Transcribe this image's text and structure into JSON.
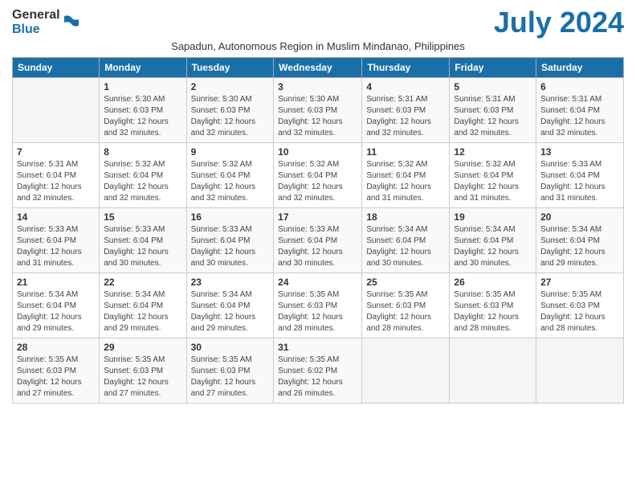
{
  "logo": {
    "general": "General",
    "blue": "Blue"
  },
  "month_title": "July 2024",
  "subtitle": "Sapadun, Autonomous Region in Muslim Mindanao, Philippines",
  "weekdays": [
    "Sunday",
    "Monday",
    "Tuesday",
    "Wednesday",
    "Thursday",
    "Friday",
    "Saturday"
  ],
  "weeks": [
    [
      {
        "day": "",
        "sunrise": "",
        "sunset": "",
        "daylight": ""
      },
      {
        "day": "1",
        "sunrise": "Sunrise: 5:30 AM",
        "sunset": "Sunset: 6:03 PM",
        "daylight": "Daylight: 12 hours and 32 minutes."
      },
      {
        "day": "2",
        "sunrise": "Sunrise: 5:30 AM",
        "sunset": "Sunset: 6:03 PM",
        "daylight": "Daylight: 12 hours and 32 minutes."
      },
      {
        "day": "3",
        "sunrise": "Sunrise: 5:30 AM",
        "sunset": "Sunset: 6:03 PM",
        "daylight": "Daylight: 12 hours and 32 minutes."
      },
      {
        "day": "4",
        "sunrise": "Sunrise: 5:31 AM",
        "sunset": "Sunset: 6:03 PM",
        "daylight": "Daylight: 12 hours and 32 minutes."
      },
      {
        "day": "5",
        "sunrise": "Sunrise: 5:31 AM",
        "sunset": "Sunset: 6:03 PM",
        "daylight": "Daylight: 12 hours and 32 minutes."
      },
      {
        "day": "6",
        "sunrise": "Sunrise: 5:31 AM",
        "sunset": "Sunset: 6:04 PM",
        "daylight": "Daylight: 12 hours and 32 minutes."
      }
    ],
    [
      {
        "day": "7",
        "sunrise": "Sunrise: 5:31 AM",
        "sunset": "Sunset: 6:04 PM",
        "daylight": "Daylight: 12 hours and 32 minutes."
      },
      {
        "day": "8",
        "sunrise": "Sunrise: 5:32 AM",
        "sunset": "Sunset: 6:04 PM",
        "daylight": "Daylight: 12 hours and 32 minutes."
      },
      {
        "day": "9",
        "sunrise": "Sunrise: 5:32 AM",
        "sunset": "Sunset: 6:04 PM",
        "daylight": "Daylight: 12 hours and 32 minutes."
      },
      {
        "day": "10",
        "sunrise": "Sunrise: 5:32 AM",
        "sunset": "Sunset: 6:04 PM",
        "daylight": "Daylight: 12 hours and 32 minutes."
      },
      {
        "day": "11",
        "sunrise": "Sunrise: 5:32 AM",
        "sunset": "Sunset: 6:04 PM",
        "daylight": "Daylight: 12 hours and 31 minutes."
      },
      {
        "day": "12",
        "sunrise": "Sunrise: 5:32 AM",
        "sunset": "Sunset: 6:04 PM",
        "daylight": "Daylight: 12 hours and 31 minutes."
      },
      {
        "day": "13",
        "sunrise": "Sunrise: 5:33 AM",
        "sunset": "Sunset: 6:04 PM",
        "daylight": "Daylight: 12 hours and 31 minutes."
      }
    ],
    [
      {
        "day": "14",
        "sunrise": "Sunrise: 5:33 AM",
        "sunset": "Sunset: 6:04 PM",
        "daylight": "Daylight: 12 hours and 31 minutes."
      },
      {
        "day": "15",
        "sunrise": "Sunrise: 5:33 AM",
        "sunset": "Sunset: 6:04 PM",
        "daylight": "Daylight: 12 hours and 30 minutes."
      },
      {
        "day": "16",
        "sunrise": "Sunrise: 5:33 AM",
        "sunset": "Sunset: 6:04 PM",
        "daylight": "Daylight: 12 hours and 30 minutes."
      },
      {
        "day": "17",
        "sunrise": "Sunrise: 5:33 AM",
        "sunset": "Sunset: 6:04 PM",
        "daylight": "Daylight: 12 hours and 30 minutes."
      },
      {
        "day": "18",
        "sunrise": "Sunrise: 5:34 AM",
        "sunset": "Sunset: 6:04 PM",
        "daylight": "Daylight: 12 hours and 30 minutes."
      },
      {
        "day": "19",
        "sunrise": "Sunrise: 5:34 AM",
        "sunset": "Sunset: 6:04 PM",
        "daylight": "Daylight: 12 hours and 30 minutes."
      },
      {
        "day": "20",
        "sunrise": "Sunrise: 5:34 AM",
        "sunset": "Sunset: 6:04 PM",
        "daylight": "Daylight: 12 hours and 29 minutes."
      }
    ],
    [
      {
        "day": "21",
        "sunrise": "Sunrise: 5:34 AM",
        "sunset": "Sunset: 6:04 PM",
        "daylight": "Daylight: 12 hours and 29 minutes."
      },
      {
        "day": "22",
        "sunrise": "Sunrise: 5:34 AM",
        "sunset": "Sunset: 6:04 PM",
        "daylight": "Daylight: 12 hours and 29 minutes."
      },
      {
        "day": "23",
        "sunrise": "Sunrise: 5:34 AM",
        "sunset": "Sunset: 6:04 PM",
        "daylight": "Daylight: 12 hours and 29 minutes."
      },
      {
        "day": "24",
        "sunrise": "Sunrise: 5:35 AM",
        "sunset": "Sunset: 6:03 PM",
        "daylight": "Daylight: 12 hours and 28 minutes."
      },
      {
        "day": "25",
        "sunrise": "Sunrise: 5:35 AM",
        "sunset": "Sunset: 6:03 PM",
        "daylight": "Daylight: 12 hours and 28 minutes."
      },
      {
        "day": "26",
        "sunrise": "Sunrise: 5:35 AM",
        "sunset": "Sunset: 6:03 PM",
        "daylight": "Daylight: 12 hours and 28 minutes."
      },
      {
        "day": "27",
        "sunrise": "Sunrise: 5:35 AM",
        "sunset": "Sunset: 6:03 PM",
        "daylight": "Daylight: 12 hours and 28 minutes."
      }
    ],
    [
      {
        "day": "28",
        "sunrise": "Sunrise: 5:35 AM",
        "sunset": "Sunset: 6:03 PM",
        "daylight": "Daylight: 12 hours and 27 minutes."
      },
      {
        "day": "29",
        "sunrise": "Sunrise: 5:35 AM",
        "sunset": "Sunset: 6:03 PM",
        "daylight": "Daylight: 12 hours and 27 minutes."
      },
      {
        "day": "30",
        "sunrise": "Sunrise: 5:35 AM",
        "sunset": "Sunset: 6:03 PM",
        "daylight": "Daylight: 12 hours and 27 minutes."
      },
      {
        "day": "31",
        "sunrise": "Sunrise: 5:35 AM",
        "sunset": "Sunset: 6:02 PM",
        "daylight": "Daylight: 12 hours and 26 minutes."
      },
      {
        "day": "",
        "sunrise": "",
        "sunset": "",
        "daylight": ""
      },
      {
        "day": "",
        "sunrise": "",
        "sunset": "",
        "daylight": ""
      },
      {
        "day": "",
        "sunrise": "",
        "sunset": "",
        "daylight": ""
      }
    ]
  ]
}
